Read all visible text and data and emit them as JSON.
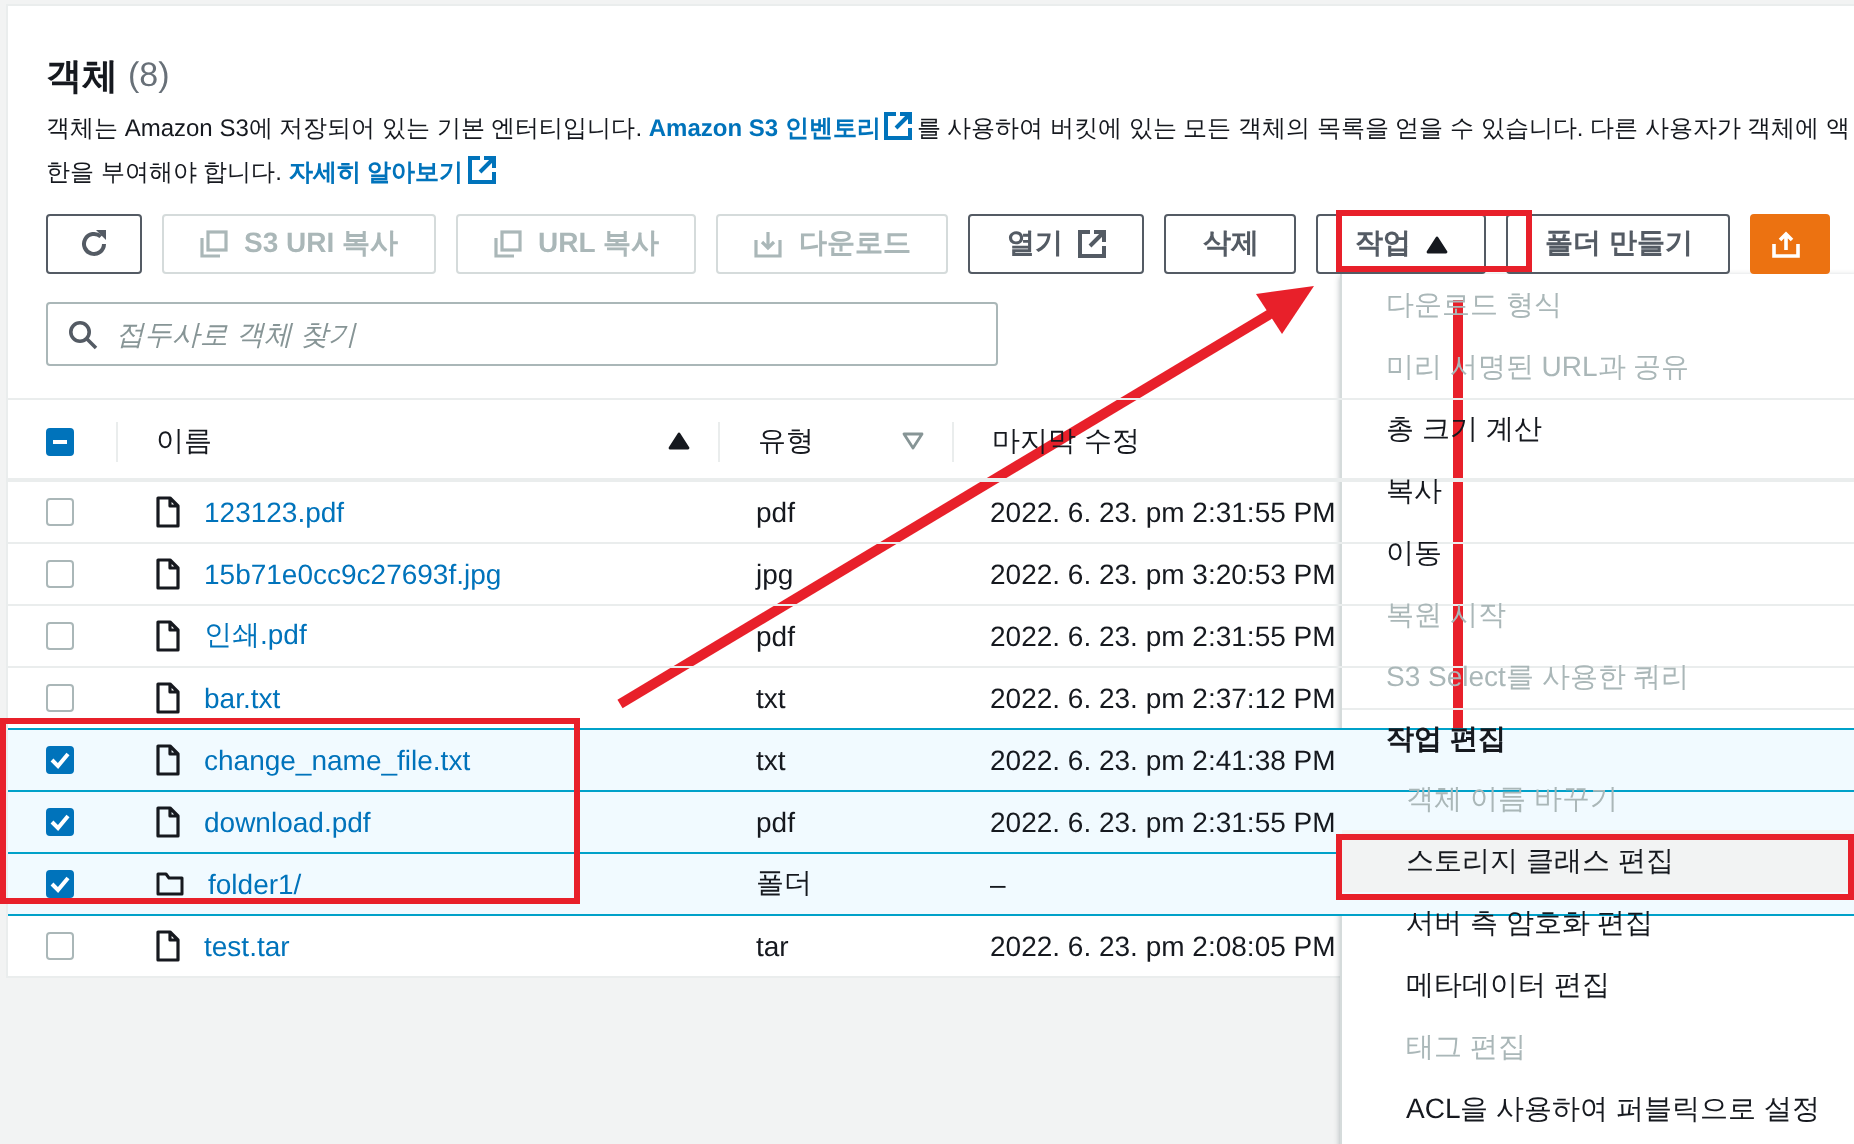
{
  "header": {
    "title": "객체",
    "count": "(8)"
  },
  "description": {
    "line_1": {
      "text": "객체는 Amazon S3에 저장되어 있는 기본 엔터티입니다. ",
      "link": "Amazon S3 인벤토리",
      "after": "를 사용하여 버킷에 있는 모든 객체의 목록을 얻을 수 있습니다. 다른 사용자가 객체에 액"
    },
    "line_2": {
      "text": "한을 부여해야 합니다. ",
      "link": "자세히 알아보기"
    }
  },
  "toolbar": [
    {
      "kind": "refresh",
      "disabled": false
    },
    {
      "kind": "copy",
      "label": "S3 URI 복사",
      "disabled": true
    },
    {
      "kind": "copy",
      "label": "URL 복사",
      "disabled": true
    },
    {
      "kind": "download",
      "label": "다운로드",
      "disabled": true
    },
    {
      "kind": "external",
      "label": "열기",
      "disabled": false
    },
    {
      "kind": "plain",
      "label": "삭제",
      "disabled": false
    },
    {
      "kind": "dropdown",
      "label": "작업",
      "disabled": false,
      "expanded": true
    },
    {
      "kind": "plain",
      "label": "폴더 만들기",
      "disabled": false
    },
    {
      "kind": "upload",
      "disabled": false
    }
  ],
  "search": {
    "placeholder": "접두사로 객체 찾기"
  },
  "table": {
    "header_checkbox": {
      "indeterminate": true
    },
    "columns": [
      {
        "label": "이름",
        "sorted": true
      },
      {
        "label": "유형",
        "sorted": false
      },
      {
        "label": "마지막 수정"
      }
    ],
    "rows": [
      {
        "kind": "file",
        "name": "123123.pdf",
        "type": "pdf",
        "modified": "2022. 6. 23. pm 2:31:55 PM",
        "checked": false
      },
      {
        "kind": "file",
        "name": "15b71e0cc9c27693f.jpg",
        "type": "jpg",
        "modified": "2022. 6. 23. pm 3:20:53 PM",
        "checked": false
      },
      {
        "kind": "file",
        "name": "인쇄.pdf",
        "type": "pdf",
        "modified": "2022. 6. 23. pm 2:31:55 PM",
        "checked": false
      },
      {
        "kind": "file",
        "name": "bar.txt",
        "type": "txt",
        "modified": "2022. 6. 23. pm 2:37:12 PM",
        "checked": false
      },
      {
        "kind": "file",
        "name": "change_name_file.txt",
        "type": "txt",
        "modified": "2022. 6. 23. pm 2:41:38 PM",
        "checked": true
      },
      {
        "kind": "file",
        "name": "download.pdf",
        "type": "pdf",
        "modified": "2022. 6. 23. pm 2:31:55 PM",
        "checked": true
      },
      {
        "kind": "folder",
        "name": "folder1/",
        "type": "폴더",
        "modified": "–",
        "checked": true
      },
      {
        "kind": "file",
        "name": "test.tar",
        "type": "tar",
        "modified": "2022. 6. 23. pm 2:08:05 PM",
        "checked": false
      }
    ]
  },
  "menu": {
    "items": [
      {
        "kind": "item",
        "label": "다운로드 형식",
        "disabled": true,
        "hovered": false
      },
      {
        "kind": "item",
        "label": "미리 서명된 URL과 공유",
        "disabled": true,
        "hovered": false
      },
      {
        "kind": "item",
        "label": "총 크기 계산",
        "disabled": false,
        "hovered": false
      },
      {
        "kind": "item",
        "label": "복사",
        "disabled": false,
        "hovered": false
      },
      {
        "kind": "item",
        "label": "이동",
        "disabled": false,
        "hovered": false
      },
      {
        "kind": "item",
        "label": "복원 시작",
        "disabled": true,
        "hovered": false
      },
      {
        "kind": "item",
        "label": "S3 Select를 사용한 쿼리",
        "disabled": true,
        "hovered": false
      },
      {
        "kind": "group",
        "label": "작업 편집",
        "children": [
          {
            "label": "객체 이름 바꾸기",
            "disabled": true,
            "hovered": false
          },
          {
            "label": "스토리지 클래스 편집",
            "disabled": false,
            "hovered": true
          },
          {
            "label": "서버 측 암호화 편집",
            "disabled": false,
            "hovered": false
          },
          {
            "label": "메타데이터 편집",
            "disabled": false,
            "hovered": false
          },
          {
            "label": "태그 편집",
            "disabled": true,
            "hovered": false
          },
          {
            "label": "ACL을 사용하여 퍼블릭으로 설정",
            "disabled": false,
            "hovered": false
          }
        ]
      }
    ]
  }
}
